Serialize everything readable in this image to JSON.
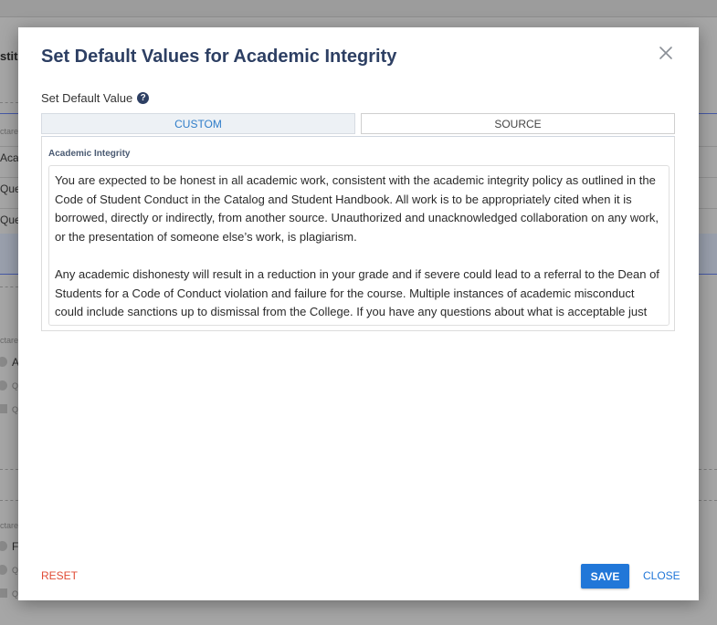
{
  "background": {
    "fragments": {
      "heading": "stitu",
      "row_1": "Acad",
      "row_2": "Ques",
      "row_3": "Ques",
      "label_1": "ctare",
      "item_1": "A",
      "item_2": "Q",
      "item_3": "Q",
      "label_2": "ctare",
      "item_4": "F",
      "item_5": "Q",
      "item_6": "Q"
    }
  },
  "modal": {
    "title": "Set Default Values for Academic Integrity",
    "close_icon": "close-icon",
    "field_label": "Set Default Value",
    "help_icon_glyph": "?",
    "tabs": [
      {
        "label": "CUSTOM",
        "active": true
      },
      {
        "label": "SOURCE",
        "active": false
      }
    ],
    "panel_label": "Academic Integrity",
    "text_paragraphs": [
      "You are expected to be honest in all academic work, consistent with the academic integrity policy as outlined in the Code of Student Conduct in the Catalog and Student Handbook. All work is to be appropriately cited when it is borrowed, directly or indirectly, from another source. Unauthorized and unacknowledged collaboration on any work, or the presentation of someone else’s work, is plagiarism.",
      "Any academic dishonesty will result in a reduction in your grade and if severe could lead to a referral to the Dean of Students for a Code of Conduct violation and failure for the course. Multiple instances of academic misconduct could include sanctions up to dismissal from the College. If you have any questions about what is acceptable just ask."
    ],
    "footer": {
      "reset_label": "RESET",
      "save_label": "SAVE",
      "close_label": "CLOSE"
    }
  },
  "colors": {
    "title": "#2d3f63",
    "accent": "#2177d8",
    "reset": "#e04b35",
    "active_tab_bg": "#edf1f5"
  }
}
